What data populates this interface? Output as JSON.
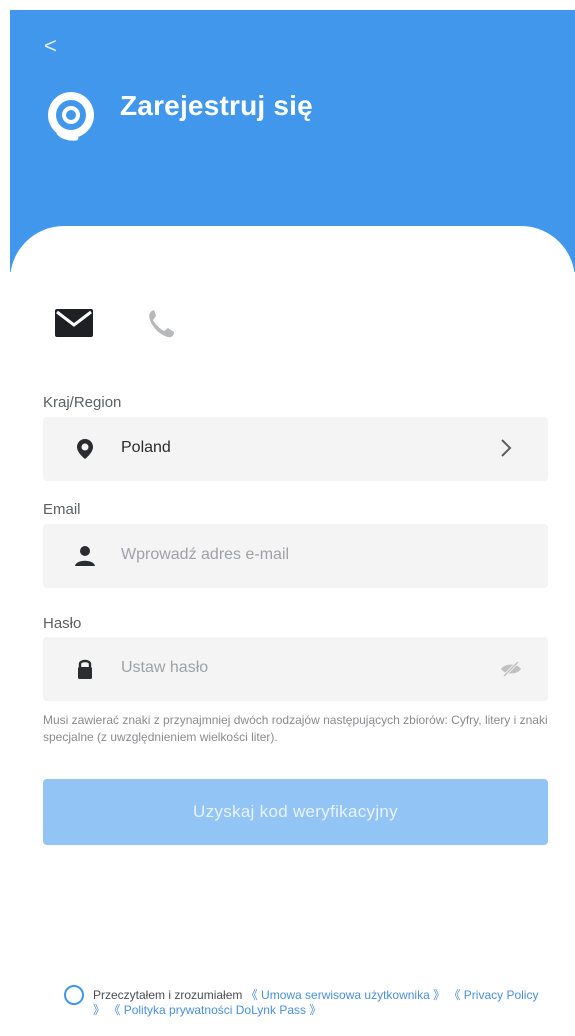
{
  "header": {
    "back_label": "<",
    "title": "Zarejestruj się",
    "brand_color": "#4097ec"
  },
  "tabs": [
    {
      "name": "email-icon"
    },
    {
      "name": "phone-icon"
    }
  ],
  "form": {
    "country_label": "Kraj/Region",
    "country_value": "Poland",
    "email_label": "Email",
    "email_placeholder": "Wprowadź adres e-mail",
    "password_label": "Hasło",
    "password_placeholder": "Ustaw hasło",
    "password_hint": "Musi zawierać znaki z przynajmniej dwóch rodzajów następujących zbiorów: Cyfry, litery i znaki specjalne (z uwzględnieniem wielkości liter).",
    "submit_label": "Uzyskaj kod weryfikacyjny"
  },
  "terms": {
    "prefix": "Przeczytałem i zrozumiałem ",
    "link_user_agreement": "《 Umowa serwisowa użytkownika 》",
    "link_privacy_policy": "《 Privacy Policy 》",
    "link_dolynk_privacy": "《 Polityka prywatności DoLynk Pass 》"
  }
}
